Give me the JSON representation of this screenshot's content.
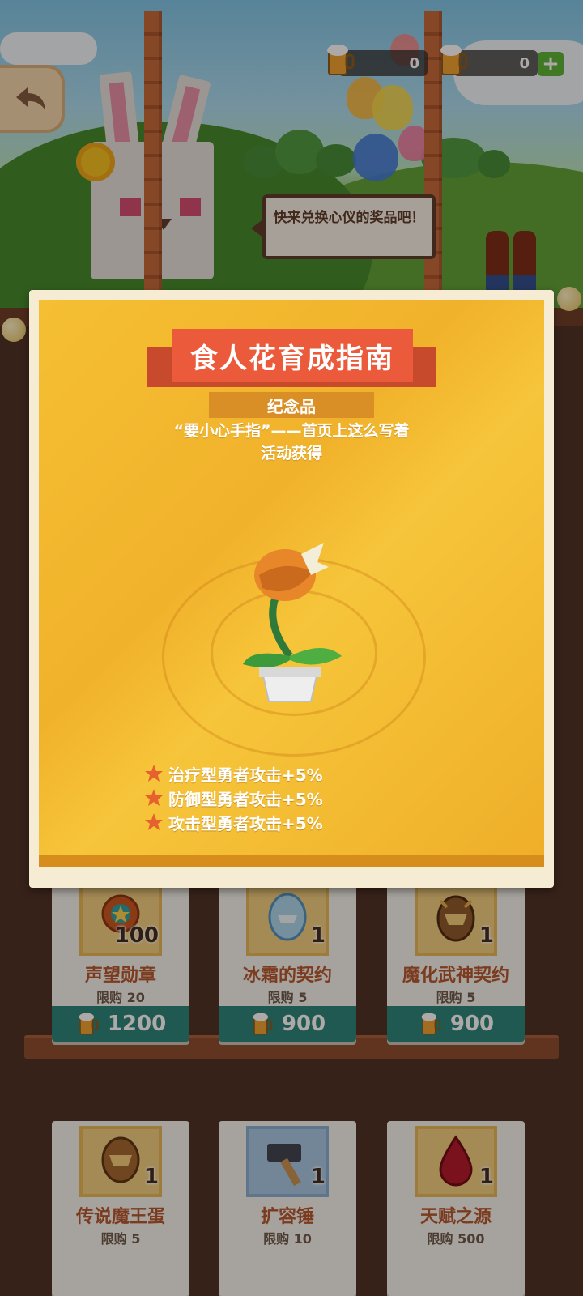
{
  "currency": {
    "item1_count": "0",
    "item2_count": "0",
    "plus_label": "+"
  },
  "npc": {
    "speech": "快来兑换心仪的奖品吧！"
  },
  "modal": {
    "title": "食人花育成指南",
    "category": "纪念品",
    "quote": "“要小心手指”——首页上这么写着",
    "source": "活动获得",
    "stats": [
      "治疗型勇者攻击+5%",
      "防御型勇者攻击+5%",
      "攻击型勇者攻击+5%"
    ]
  },
  "shop": {
    "items": [
      {
        "name": "声望勋章",
        "count": "100",
        "limit": "限购 20",
        "price": "1200",
        "icon": "medal-icon"
      },
      {
        "name": "冰霜的契约",
        "count": "1",
        "limit": "限购 5",
        "price": "900",
        "icon": "frost-egg-icon"
      },
      {
        "name": "魔化武神契约",
        "count": "1",
        "limit": "限购 5",
        "price": "900",
        "icon": "demon-egg-icon"
      },
      {
        "name": "传说魔王蛋",
        "count": "1",
        "limit": "限购 5",
        "price": "",
        "icon": "legend-egg-icon"
      },
      {
        "name": "扩容锤",
        "count": "1",
        "limit": "限购 10",
        "price": "",
        "icon": "hammer-icon"
      },
      {
        "name": "天赋之源",
        "count": "1",
        "limit": "限购 500",
        "price": "",
        "icon": "blood-drop-icon"
      }
    ]
  }
}
